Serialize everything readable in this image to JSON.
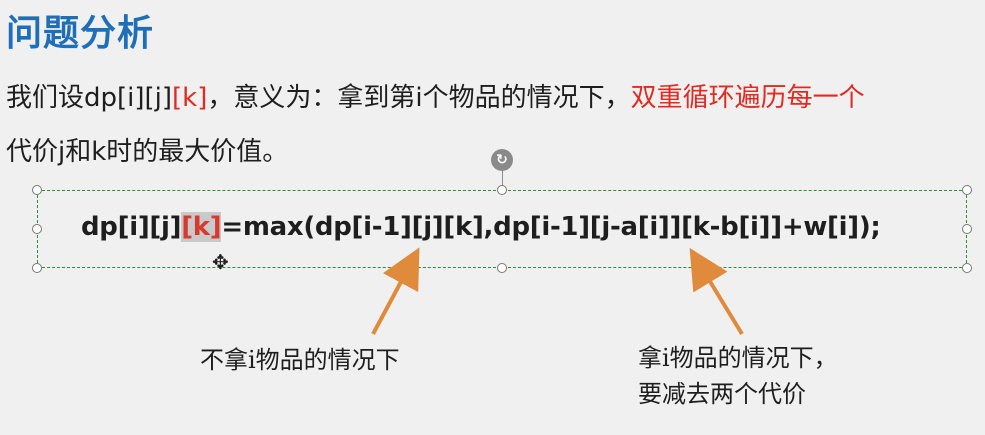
{
  "slide": {
    "title": "问题分析"
  },
  "paragraph": {
    "line1_prefix": "我们设dp[i][j]",
    "line1_red_k": "[k]",
    "line1_mid": "，意义为：拿到第i个物品的情况下，",
    "line1_red_tail": "双重循环遍历每一个",
    "line2": "代价j和k时的最大价值。"
  },
  "formula": {
    "before_highlight": "dp[i][j]",
    "highlight": "[k]",
    "after_highlight": "=max(dp[i-1][j][k],dp[i-1][j-a[i]][k-b[i]]+w[i]);"
  },
  "annotations": {
    "left": "不拿i物品的情况下",
    "right_line1": "拿i物品的情况下，",
    "right_line2": "要减去两个代价"
  },
  "colors": {
    "title": "#1f6fb8",
    "red": "#e02a22",
    "arrow": "#e08a3c",
    "selection": "#2e8b3a"
  },
  "icons": {
    "rotate": "rotate-icon",
    "cursor": "move-cursor-icon"
  }
}
